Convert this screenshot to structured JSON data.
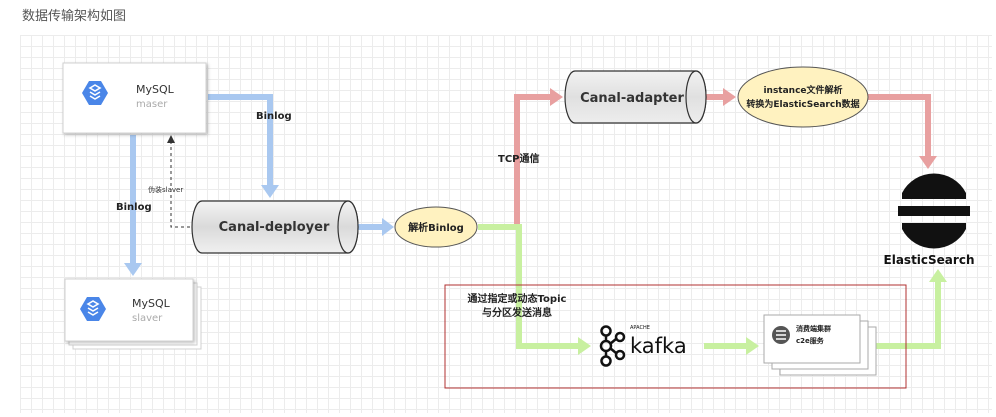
{
  "heading": "数据传输架构如图",
  "nodes": {
    "mysql_master": {
      "title": "MySQL",
      "subtitle": "maser"
    },
    "mysql_slave": {
      "title": "MySQL",
      "subtitle": "slaver"
    },
    "canal_deployer": {
      "label": "Canal-deployer"
    },
    "canal_adapter": {
      "label": "Canal-adapter"
    },
    "parse_binlog": {
      "label": "解析Binlog"
    },
    "instance_parse": {
      "line1": "instance文件解析",
      "line2": "转换为ElasticSearch数据"
    },
    "elasticsearch": {
      "label": "ElasticSearch"
    },
    "kafka": {
      "apache": "APACHE",
      "label": "kafka"
    },
    "consumer": {
      "line1": "消费端集群",
      "line2": "c2e服务"
    }
  },
  "edge_labels": {
    "binlog_top": "Binlog",
    "binlog_left": "Binlog",
    "fake_slave": "伪装slaver",
    "tcp": "TCP通信",
    "topic_line1": "通过指定或动态Topic",
    "topic_line2": "与分区发送消息"
  },
  "colors": {
    "blue_edge": "#a9c8f0",
    "red_edge": "#e8a0a0",
    "green_edge": "#c8f0a0",
    "highlight_box": "#b03030",
    "cloud_blue": "#4a86e8",
    "yellow_node": "#fff2c0"
  }
}
